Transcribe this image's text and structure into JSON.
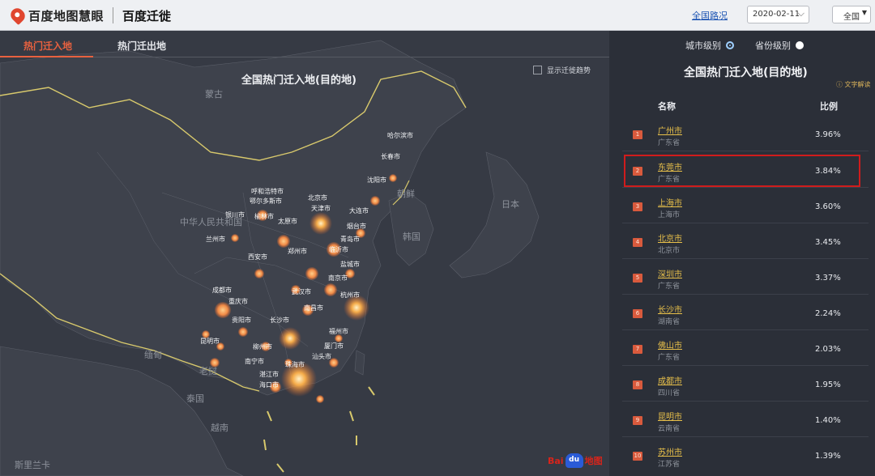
{
  "header": {
    "logo_text": "百度地图慧眼",
    "app_name": "百度迁徙",
    "national_link": "全国路况",
    "date_value": "2020-02-11",
    "region_value": "全国"
  },
  "tabs": [
    {
      "label": "热门迁入地",
      "active": true
    },
    {
      "label": "热门迁出地",
      "active": false
    }
  ],
  "map": {
    "title": "全国热门迁入地(目的地)",
    "trend_toggle_label": "显示迁徙趋势",
    "country_labels": [
      "蒙古",
      "中华人民共和国",
      "朝鲜",
      "韩国",
      "日本",
      "缅甸",
      "老挝",
      "泰国",
      "越南",
      "斯里兰卡"
    ],
    "city_labels": [
      "哈尔滨市",
      "长春市",
      "沈阳市",
      "呼和浩特市",
      "鄂尔多斯市",
      "北京市",
      "天津市",
      "大连市",
      "银川市",
      "榆林市",
      "太原市",
      "烟台市",
      "兰州市",
      "青岛市",
      "西安市",
      "郑州市",
      "临沂市",
      "盐城市",
      "南京市",
      "成都市",
      "武汉市",
      "杭州市",
      "重庆市",
      "南昌市",
      "福州市",
      "贵阳市",
      "长沙市",
      "昆明市",
      "柳州市",
      "南宁市",
      "厦门市",
      "汕头市",
      "湛江市",
      "珠海市",
      "海口市"
    ],
    "baidu_logo": "Bai du 地图",
    "accent_color": "#e8613f"
  },
  "panel": {
    "level_city": "城市级别",
    "level_province": "省份级别",
    "selected_level": "城市级别",
    "title": "全国热门迁入地(目的地)",
    "doc_link": "文字解读",
    "col_name": "名称",
    "col_ratio": "比例",
    "rows": [
      {
        "rank": "1",
        "city": "广州市",
        "province": "广东省",
        "ratio": "3.96%"
      },
      {
        "rank": "2",
        "city": "东莞市",
        "province": "广东省",
        "ratio": "3.84%"
      },
      {
        "rank": "3",
        "city": "上海市",
        "province": "上海市",
        "ratio": "3.60%"
      },
      {
        "rank": "4",
        "city": "北京市",
        "province": "北京市",
        "ratio": "3.45%"
      },
      {
        "rank": "5",
        "city": "深圳市",
        "province": "广东省",
        "ratio": "3.37%"
      },
      {
        "rank": "6",
        "city": "长沙市",
        "province": "湖南省",
        "ratio": "2.24%"
      },
      {
        "rank": "7",
        "city": "佛山市",
        "province": "广东省",
        "ratio": "2.03%"
      },
      {
        "rank": "8",
        "city": "成都市",
        "province": "四川省",
        "ratio": "1.95%"
      },
      {
        "rank": "9",
        "city": "昆明市",
        "province": "云南省",
        "ratio": "1.40%"
      },
      {
        "rank": "10",
        "city": "苏州市",
        "province": "江苏省",
        "ratio": "1.39%"
      }
    ]
  }
}
